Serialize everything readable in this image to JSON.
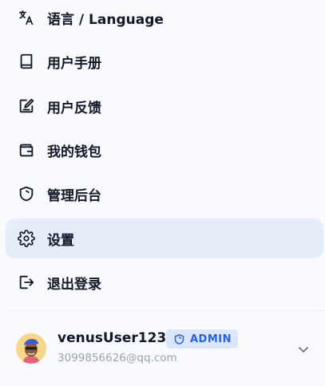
{
  "menu": {
    "items": [
      {
        "label": "语言 / Language",
        "icon": "translate-icon"
      },
      {
        "label": "用户手册",
        "icon": "book-icon"
      },
      {
        "label": "用户反馈",
        "icon": "feedback-edit-icon"
      },
      {
        "label": "我的钱包",
        "icon": "wallet-icon"
      },
      {
        "label": "管理后台",
        "icon": "shield-icon"
      },
      {
        "label": "设置",
        "icon": "gear-icon",
        "active": true
      },
      {
        "label": "退出登录",
        "icon": "logout-icon"
      }
    ]
  },
  "user": {
    "name": "venusUser123",
    "role": "ADMIN",
    "email": "3099856626@qq.com"
  },
  "colors": {
    "active_bg": "#e5edfb",
    "badge_bg": "#dbe6fb",
    "badge_text": "#2563eb",
    "text": "#111827",
    "muted": "#9aa3b1"
  }
}
